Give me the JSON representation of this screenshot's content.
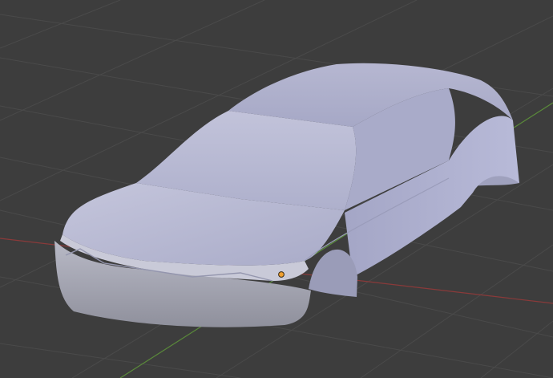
{
  "viewport": {
    "mode": "3d-viewport",
    "shading": "solid",
    "background_color": "#3d3d3d",
    "grid_color": "#4a4a4a",
    "x_axis_color": "#8a3a3a",
    "y_axis_color": "#5a8a3a",
    "object": {
      "kind": "car-body-mesh",
      "base_color": "#b4b6d6",
      "shadow_color": "#8e90a6",
      "origin_color": "#f0a030"
    }
  }
}
